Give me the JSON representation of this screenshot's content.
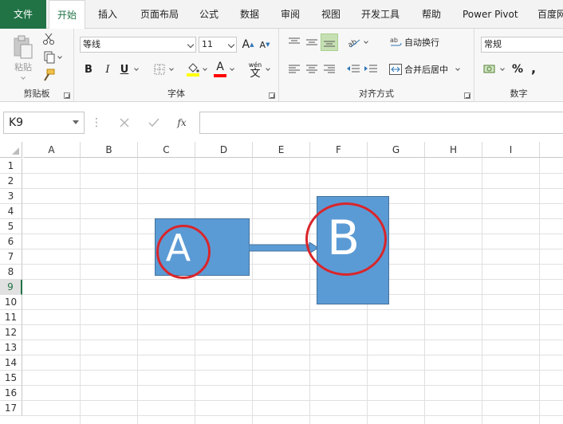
{
  "tabs": [
    "文件",
    "开始",
    "插入",
    "页面布局",
    "公式",
    "数据",
    "审阅",
    "视图",
    "开发工具",
    "帮助",
    "Power Pivot",
    "百度网"
  ],
  "ribbon": {
    "clipboard": {
      "label": "剪贴板",
      "paste_label": "粘贴"
    },
    "font": {
      "label": "字体",
      "font_name": "等线",
      "font_size": "11",
      "bold": "B",
      "italic": "I",
      "underline": "U",
      "grow": "A",
      "shrink": "A",
      "font_color_letter": "A",
      "phonetic": "wén",
      "phonetic_char": "文",
      "fill_color": "#ffff00",
      "font_color": "#ff0000"
    },
    "alignment": {
      "label": "对齐方式",
      "wrap_text": "自动换行",
      "merge_center": "合并后居中"
    },
    "number": {
      "label": "数字",
      "format": "常规",
      "percent": "%",
      "comma": ","
    }
  },
  "formula_bar": {
    "name_box": "K9",
    "fx": "fx",
    "value": ""
  },
  "columns": [
    "A",
    "B",
    "C",
    "D",
    "E",
    "F",
    "G",
    "H",
    "I"
  ],
  "rows": [
    "1",
    "2",
    "3",
    "4",
    "5",
    "6",
    "7",
    "8",
    "9",
    "10",
    "11",
    "12",
    "13",
    "14",
    "15",
    "16",
    "17"
  ],
  "selected_row": "9",
  "shapes": {
    "a_label": "A",
    "b_label": "B",
    "fill": "#5b9bd5",
    "highlight": "#d9262b"
  }
}
